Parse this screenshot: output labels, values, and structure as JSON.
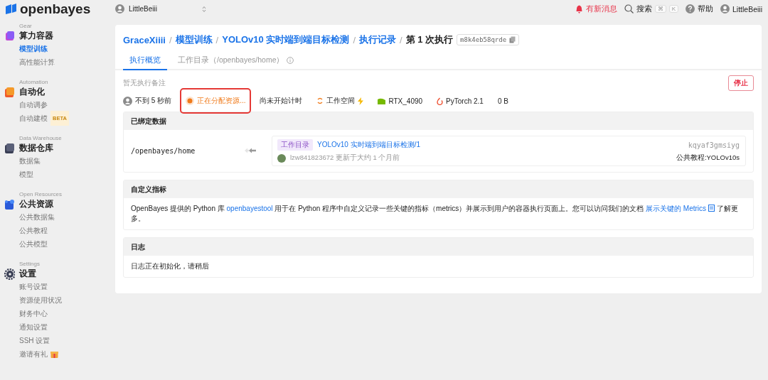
{
  "logo": {
    "text": "openbayes"
  },
  "workspace_switcher": {
    "name": "LittleBeiii"
  },
  "header": {
    "notification": "有新消息",
    "search": "搜索",
    "shortcut_keys": [
      "⌘",
      "K"
    ],
    "help": "帮助",
    "user": "LittleBeiii"
  },
  "sidebar": {
    "sections": [
      {
        "caption": "Gear",
        "title": "算力容器",
        "kind": "gear",
        "items": [
          {
            "label": "模型训练",
            "selected": true
          },
          {
            "label": "高性能计算",
            "selected": false
          }
        ]
      },
      {
        "caption": "Automation",
        "title": "自动化",
        "kind": "automation",
        "items": [
          {
            "label": "自动调参",
            "selected": false
          },
          {
            "label": "自动建模",
            "selected": false,
            "badge": "BETA"
          }
        ]
      },
      {
        "caption": "Data Warehouse",
        "title": "数据仓库",
        "kind": "data",
        "items": [
          {
            "label": "数据集",
            "selected": false
          },
          {
            "label": "模型",
            "selected": false
          }
        ]
      },
      {
        "caption": "Open Resources",
        "title": "公共资源",
        "kind": "open",
        "items": [
          {
            "label": "公共数据集",
            "selected": false
          },
          {
            "label": "公共教程",
            "selected": false
          },
          {
            "label": "公共模型",
            "selected": false
          }
        ]
      },
      {
        "caption": "Settings",
        "title": "设置",
        "kind": "settings",
        "items": [
          {
            "label": "账号设置",
            "selected": false
          },
          {
            "label": "资源使用状况",
            "selected": false
          },
          {
            "label": "财务中心",
            "selected": false
          },
          {
            "label": "通知设置",
            "selected": false
          },
          {
            "label": "SSH 设置",
            "selected": false
          },
          {
            "label": "邀请有礼",
            "selected": false,
            "gift": true
          }
        ]
      }
    ]
  },
  "breadcrumb": {
    "links": [
      "GraceXiiii",
      "模型训练",
      "YOLOv10 实时端到端目标检测",
      "执行记录"
    ],
    "separator": "/",
    "current": "第 1 次执行",
    "id": "m8k4eb58qrde"
  },
  "tabs": [
    {
      "label": "执行概览",
      "selected": true
    },
    {
      "label": "工作目录（/openbayes/home）",
      "selected": false,
      "info": true
    }
  ],
  "note": "暂无执行备注",
  "stop_button": "停止",
  "meta": [
    {
      "kind": "user",
      "text": "不到 5 秒前"
    },
    {
      "kind": "status",
      "text": "正在分配资源...",
      "highlighted": true
    },
    {
      "kind": "plain",
      "text": "尚未开始计时"
    },
    {
      "kind": "workspace",
      "text": "工作空间"
    },
    {
      "kind": "gpu",
      "text": "RTX_4090"
    },
    {
      "kind": "framework",
      "text": "PyTorch 2.1"
    },
    {
      "kind": "plain",
      "text": "0 B"
    }
  ],
  "bound_data": {
    "title": "已绑定数据",
    "path": "/openbayes/home",
    "source": {
      "tag": "工作目录",
      "name": "YOLOv10 实时端到端目标检测/1",
      "hash": "kqyaf3gmsiyg",
      "user": "lzw841823672",
      "updated": "更新于大约 1 个月前",
      "origin": "公共教程:YOLOv10s"
    }
  },
  "metrics": {
    "title": "自定义指标",
    "parts": [
      {
        "kind": "text",
        "text": "OpenBayes 提供的 Python 库 "
      },
      {
        "kind": "link",
        "text": "openbayestool"
      },
      {
        "kind": "text",
        "text": " 用于在 Python 程序中自定义记录一些关键的指标（metrics）并展示到用户的容器执行页面上。您可以访问我们的文档 "
      },
      {
        "kind": "doc_link",
        "text": "展示关键的 Metrics"
      },
      {
        "kind": "text",
        "text": " 了解更多。"
      }
    ]
  },
  "logs": {
    "title": "日志",
    "text": "日志正在初始化，请稍后"
  }
}
